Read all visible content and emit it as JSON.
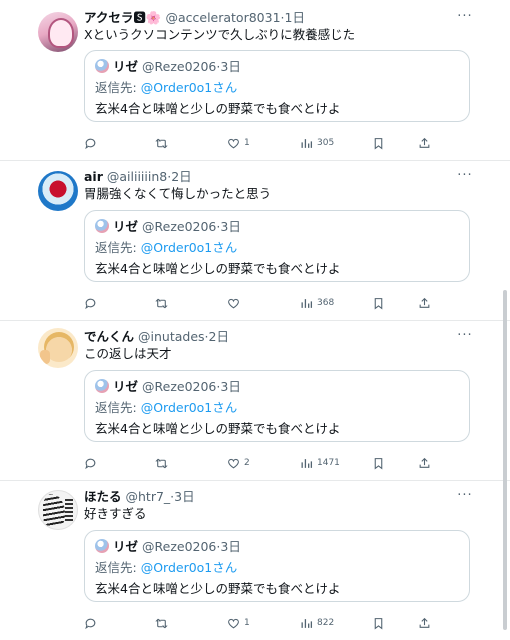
{
  "tweets": [
    {
      "name": "アクセラ",
      "name_emoji": "🌸",
      "handle": "@accelerator8031",
      "time": "1日",
      "text": "Xというクソコンテンツで久しぶりに教養感じた",
      "counts": {
        "reply": "",
        "retweet": "",
        "like": "1",
        "views": "305"
      }
    },
    {
      "name": "air",
      "handle": "@ailiiiiin8",
      "time": "2日",
      "text": "胃腸強くなくて悔しかったと思う",
      "counts": {
        "reply": "",
        "retweet": "",
        "like": "",
        "views": "368"
      }
    },
    {
      "name": "でんくん",
      "handle": "@inutades",
      "time": "2日",
      "text": "この返しは天才",
      "counts": {
        "reply": "",
        "retweet": "",
        "like": "2",
        "views": "1471"
      }
    },
    {
      "name": "ほたる",
      "handle": "@htr7_",
      "time": "3日",
      "text": "好きすぎる",
      "counts": {
        "reply": "",
        "retweet": "",
        "like": "1",
        "views": "822"
      }
    }
  ],
  "quoted": {
    "name": "リゼ",
    "handle": "@Reze0206",
    "time": "3日",
    "reply_prefix": "返信先: ",
    "reply_mention": "@Order0o1さん",
    "text": "玄米4合と味噌と少しの野菜でも食べとけよ"
  },
  "ui": {
    "separator": "·",
    "more": "···"
  },
  "colors": {
    "text_primary": "#0f1419",
    "text_secondary": "#536471",
    "link": "#1d9bf0",
    "border": "#cfd9de"
  },
  "icons": [
    "more-icon",
    "reply-icon",
    "retweet-icon",
    "like-icon",
    "views-icon",
    "bookmark-icon",
    "share-icon"
  ]
}
